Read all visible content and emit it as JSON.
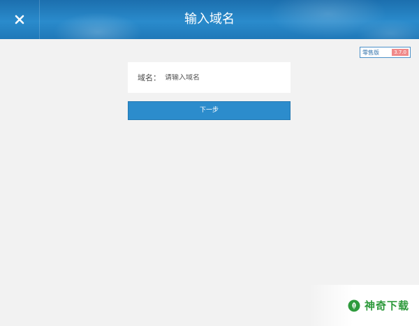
{
  "header": {
    "title": "输入域名",
    "close_icon": "close-icon"
  },
  "edition": {
    "label": "零售版",
    "version": "3.7.0"
  },
  "domain_form": {
    "label": "域名：",
    "placeholder": "请输入域名",
    "value": ""
  },
  "next_button": {
    "label": "下一步"
  },
  "watermark": {
    "text": "神奇下载",
    "icon": "leaf-logo-icon"
  },
  "colors": {
    "header": "#2a8bcc",
    "button": "#2c8ccc",
    "background": "#f2f2f2",
    "version_badge": "#f08a8a",
    "watermark": "#2e9a3c"
  }
}
